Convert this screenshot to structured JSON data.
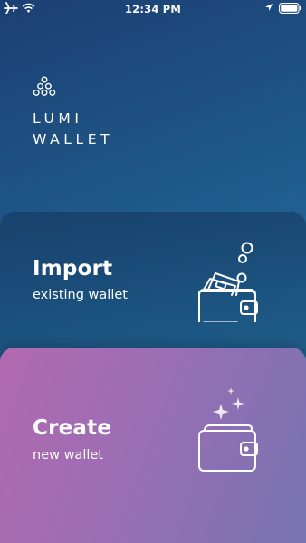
{
  "status_bar": {
    "time": "12:34 PM",
    "icons": [
      "airplane-icon",
      "wifi-icon",
      "location-arrow-icon",
      "battery-icon"
    ]
  },
  "logo": {
    "icon": "triangle-dots-logo-icon",
    "line1": "LUMI",
    "line2": "WALLET"
  },
  "import_card": {
    "title": "Import",
    "subtitle": "existing wallet",
    "icon": "wallet-with-cash-and-coins-icon"
  },
  "create_card": {
    "title": "Create",
    "subtitle": "new wallet",
    "icon": "wallet-with-sparkles-icon"
  },
  "colors": {
    "background_top": "#1c3f73",
    "background_bottom": "#2f93bd",
    "create_card_left": "#b269b1",
    "create_card_right": "#7774b2",
    "text": "#ffffff"
  }
}
